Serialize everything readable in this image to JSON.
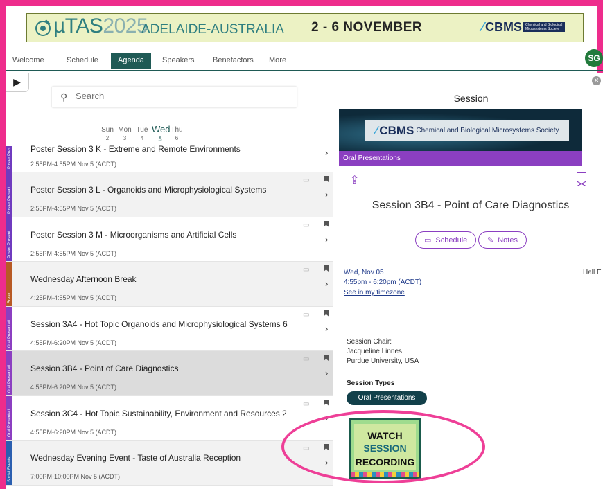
{
  "banner": {
    "event_prefix": "µTAS",
    "event_year": "2025",
    "location": "ADELAIDE-AUSTRALIA",
    "dates": "2 - 6 NOVEMBER",
    "sponsor": "CBMS",
    "sponsor_sub": "Chemical and Biological Microsystems Society"
  },
  "nav": {
    "tabs": [
      "Welcome",
      "Schedule",
      "Agenda",
      "Speakers",
      "Benefactors",
      "More"
    ],
    "active": "Agenda",
    "avatar_initials": "SG"
  },
  "search": {
    "placeholder": "Search"
  },
  "days": [
    {
      "name": "Sun",
      "num": "2"
    },
    {
      "name": "Mon",
      "num": "3"
    },
    {
      "name": "Tue",
      "num": "4"
    },
    {
      "name": "Wed",
      "num": "5",
      "selected": true
    },
    {
      "name": "Thu",
      "num": "6"
    }
  ],
  "sessions": [
    {
      "title": "Poster Session 3 K - Extreme and Remote Environments",
      "time": "2:55PM-4:55PM Nov 5 (ACDT)",
      "category": "Poster Pres...",
      "color": "#6f3bbf"
    },
    {
      "title": "Poster Session 3 L - Organoids and Microphysiological Systems",
      "time": "2:55PM-4:55PM Nov 5 (ACDT)",
      "category": "Poster Present...",
      "color": "#6f3bbf"
    },
    {
      "title": "Poster Session 3 M - Microorganisms and Artificial Cells",
      "time": "2:55PM-4:55PM Nov 5 (ACDT)",
      "category": "Poster Present...",
      "color": "#6f3bbf"
    },
    {
      "title": "Wednesday Afternoon Break",
      "time": "4:25PM-4:55PM Nov 5 (ACDT)",
      "category": "Break",
      "color": "#b85a24"
    },
    {
      "title": "Session 3A4 - Hot Topic Organoids and Microphysiological Systems 6",
      "time": "4:55PM-6:20PM Nov 5 (ACDT)",
      "category": "Oral Presentati...",
      "color": "#8b3fc1"
    },
    {
      "title": "Session 3B4 - Point of Care Diagnostics",
      "time": "4:55PM-6:20PM Nov 5 (ACDT)",
      "category": "Oral Presentati...",
      "color": "#8b3fc1"
    },
    {
      "title": "Session 3C4 - Hot Topic Sustainability, Environment and Resources 2",
      "time": "4:55PM-6:20PM Nov 5 (ACDT)",
      "category": "Oral Presentati...",
      "color": "#8b3fc1"
    },
    {
      "title": "Wednesday Evening Event - Taste of Australia Reception",
      "time": "7:00PM-10:00PM Nov 5 (ACDT)",
      "category": "Social Events",
      "color": "#2b5fb0"
    }
  ],
  "detail": {
    "header": "Session",
    "sponsor_bold": "CBMS",
    "sponsor_text": "Chemical and Biological Microsystems Society",
    "category": "Oral Presentations",
    "title": "Session 3B4 - Point of Care Diagnostics",
    "schedule_label": "Schedule",
    "notes_label": "Notes",
    "date": "Wed, Nov 05",
    "time": "4:55pm - 6:20pm   (ACDT)",
    "timezone_link": "See in my timezone",
    "room": "Hall E",
    "chair_label": "Session Chair:",
    "chair_name": "Jacqueline Linnes",
    "chair_affiliation": "Purdue University, USA",
    "types_label": "Session Types",
    "type_badge": "Oral Presentations"
  },
  "watch": {
    "line1": "WATCH",
    "line2": "SESSION",
    "line3": "RECORDING"
  },
  "colors": {
    "frame": "#ee2c8c",
    "accent": "#8b3fc1",
    "nav": "#1f5a55"
  }
}
